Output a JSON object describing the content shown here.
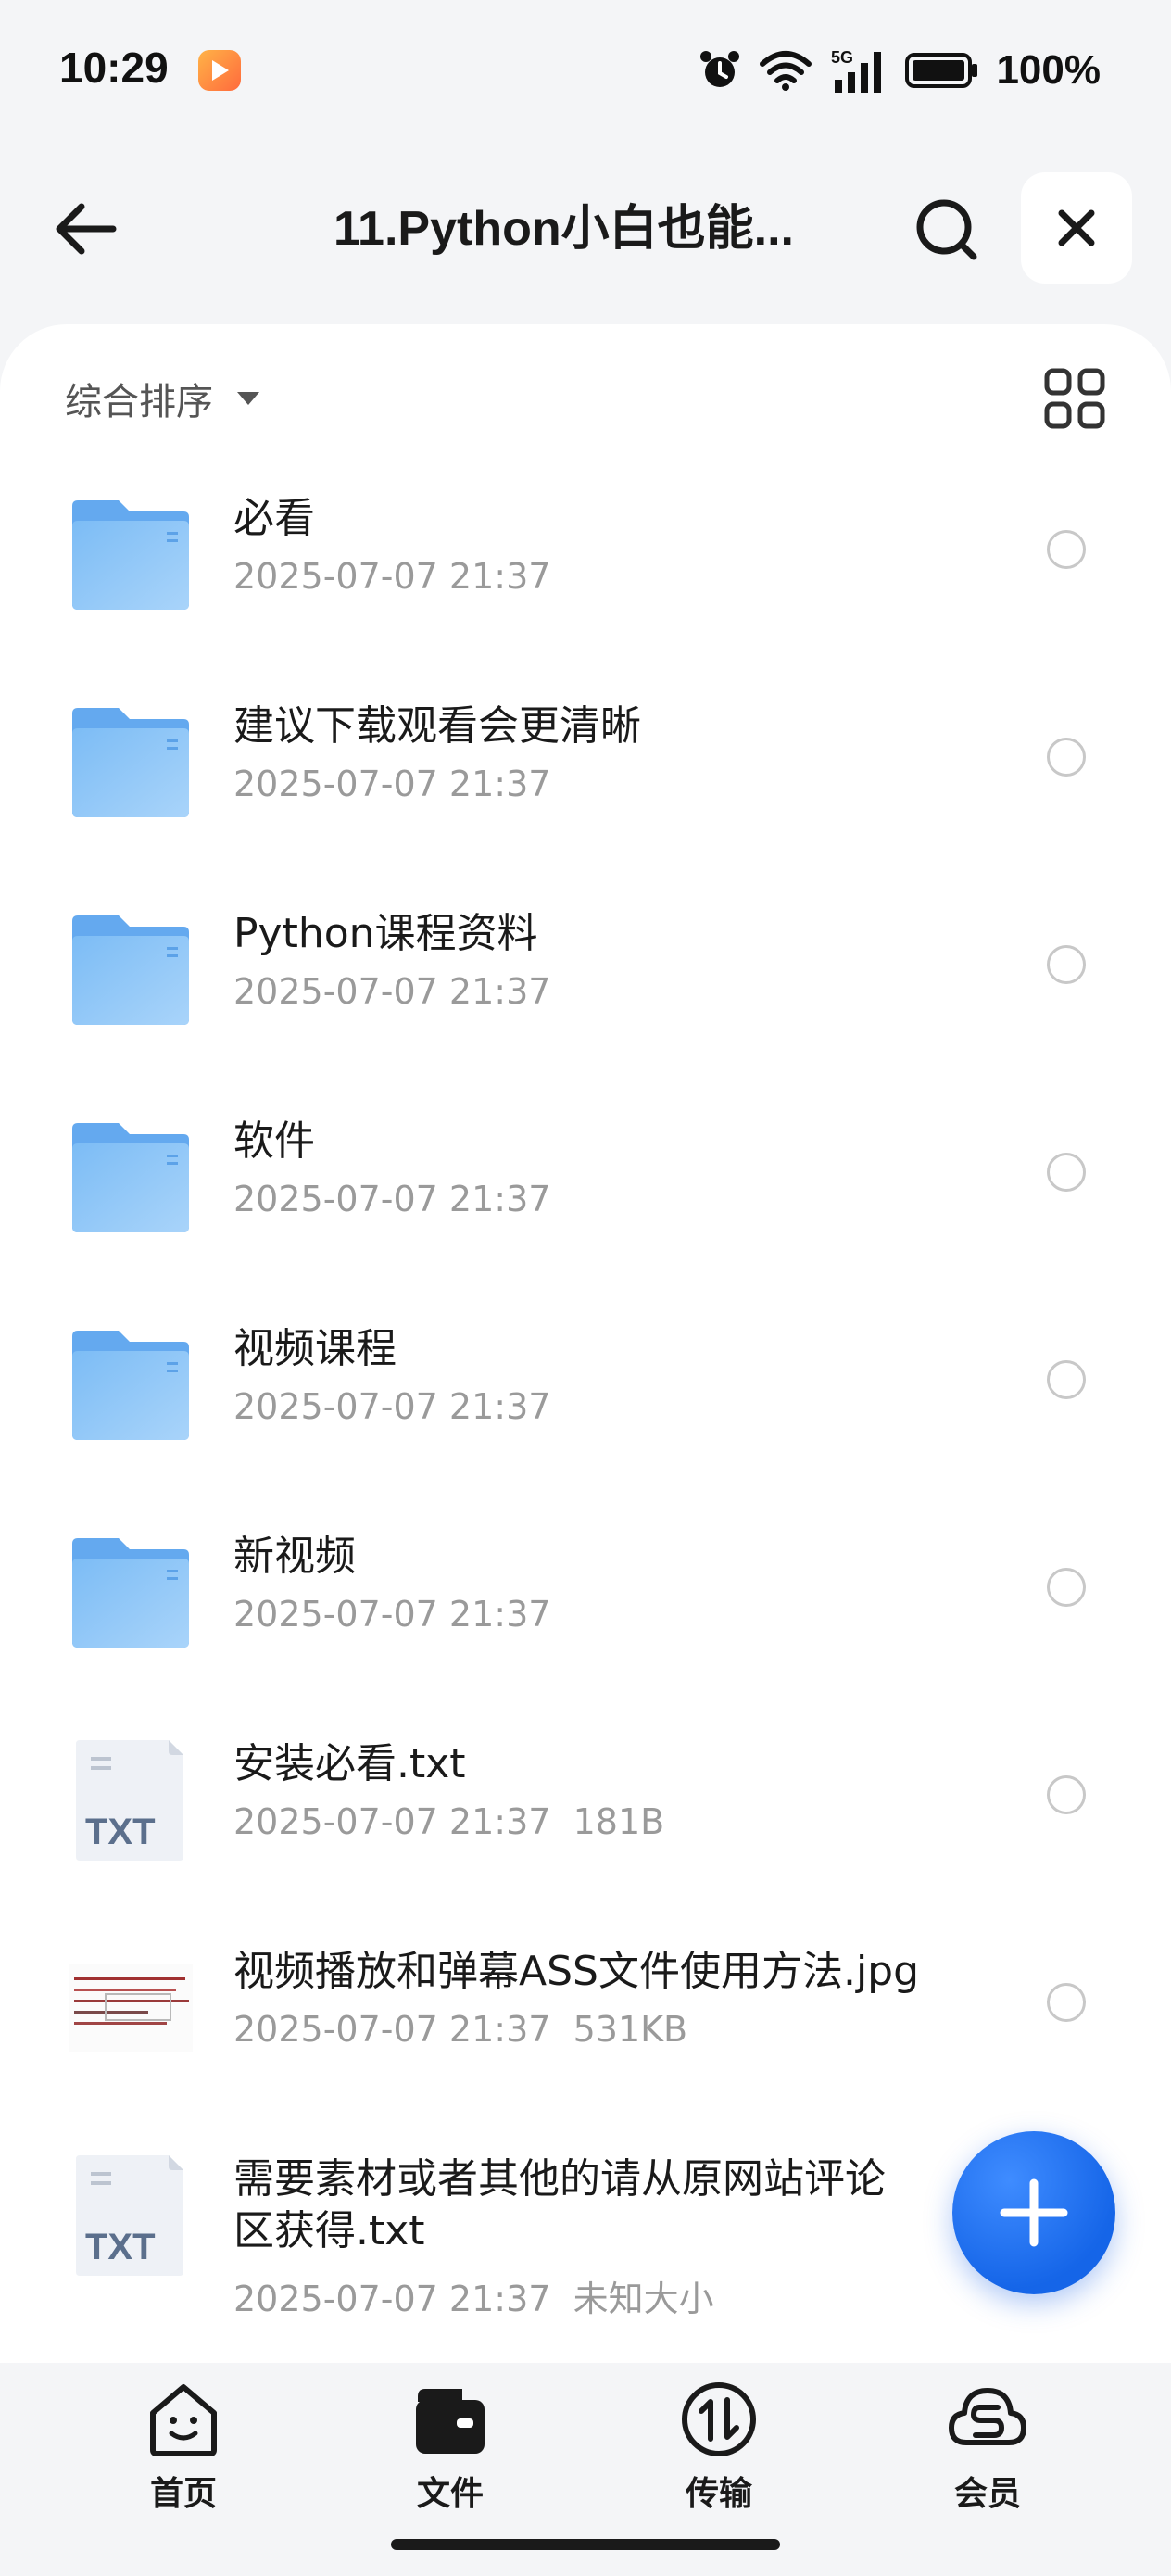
{
  "status_bar": {
    "time": "10:29",
    "battery": "100%",
    "network": "5G"
  },
  "header": {
    "title": "11.Python小白也能...",
    "back_icon": "arrow-left-icon",
    "search_icon": "search-icon",
    "close_icon": "close-icon"
  },
  "toolbar": {
    "sort_label": "综合排序",
    "view_toggle_icon": "grid-view-icon"
  },
  "files": [
    {
      "name": "必看",
      "meta": "2025-07-07 21:37",
      "type": "folder"
    },
    {
      "name": "建议下载观看会更清晰",
      "meta": "2025-07-07 21:37",
      "type": "folder"
    },
    {
      "name": "Python课程资料",
      "meta": "2025-07-07 21:37",
      "type": "folder"
    },
    {
      "name": "软件",
      "meta": "2025-07-07 21:37",
      "type": "folder"
    },
    {
      "name": "视频课程",
      "meta": "2025-07-07 21:37",
      "type": "folder"
    },
    {
      "name": "新视频",
      "meta": "2025-07-07 21:37",
      "type": "folder"
    },
    {
      "name": "安装必看.txt",
      "meta": "2025-07-07 21:37  181B",
      "type": "txt"
    },
    {
      "name": "视频播放和弹幕ASS文件使用方法.jpg",
      "meta": "2025-07-07 21:37  531KB",
      "type": "jpg"
    },
    {
      "name": "需要素材或者其他的请从原网站评论区获得.txt",
      "meta": "2025-07-07 21:37  未知大小",
      "type": "txt"
    }
  ],
  "txt_label": "TXT",
  "fab_icon": "plus-icon",
  "bottom_nav": [
    {
      "label": "首页",
      "icon": "home-face-icon"
    },
    {
      "label": "文件",
      "icon": "wallet-folder-icon"
    },
    {
      "label": "传输",
      "icon": "transfer-icon"
    },
    {
      "label": "会员",
      "icon": "vip-cloud-icon"
    }
  ],
  "colors": {
    "accent": "#1565e8",
    "folder": "#64a9ef",
    "muted_text": "#9a9a9a"
  }
}
